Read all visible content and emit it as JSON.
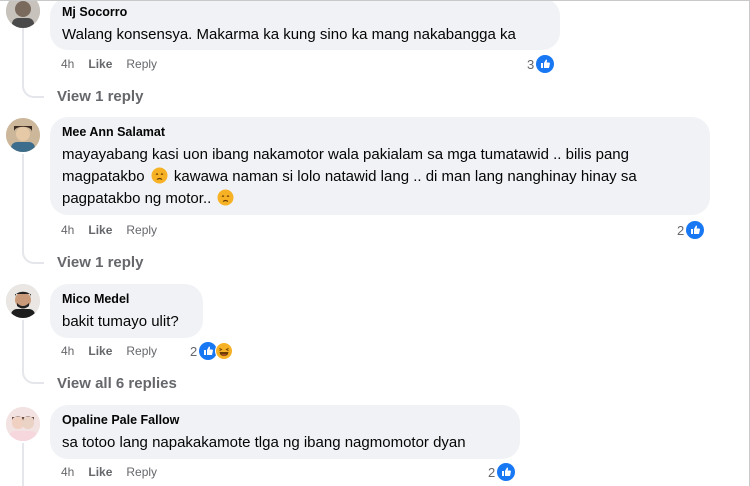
{
  "comments": [
    {
      "author": "Mj Socorro",
      "text": "Walang konsensya. Makarma ka kung sino ka mang nakabangga ka",
      "time": "4h",
      "like": "Like",
      "reply": "Reply",
      "reaction_count": "3",
      "reaction_icons": [
        "like-icon"
      ],
      "view_replies": "View 1 reply"
    },
    {
      "author": "Mee Ann Salamat",
      "text_lines": [
        "mayayabang kasi uon ibang nakamotor wala pakialam sa mga tumatawid .. bilis pang",
        "magpatakbo",
        "kawawa naman si lolo natawid lang .. di man lang nanghinay hinay sa",
        "pagpatakbo ng motor.."
      ],
      "time": "4h",
      "like": "Like",
      "reply": "Reply",
      "reaction_count": "2",
      "reaction_icons": [
        "like-icon"
      ],
      "view_replies": "View 1 reply"
    },
    {
      "author": "Mico Medel",
      "text": "bakit tumayo ulit?",
      "time": "4h",
      "like": "Like",
      "reply": "Reply",
      "reaction_count": "2",
      "reaction_icons": [
        "like-icon",
        "haha-icon"
      ],
      "view_replies": "View all 6 replies"
    },
    {
      "author": "Opaline Pale Fallow",
      "text": "sa totoo lang napakakamote tlga ng ibang nagmomotor dyan",
      "time": "4h",
      "like": "Like",
      "reply": "Reply",
      "reaction_count": "2",
      "reaction_icons": [
        "like-icon"
      ]
    }
  ],
  "colors": {
    "bubble": "#f0f2f5",
    "like_blue": "#1877f2",
    "meta_gray": "#65676b",
    "haha_yellow": "#f7b125"
  }
}
